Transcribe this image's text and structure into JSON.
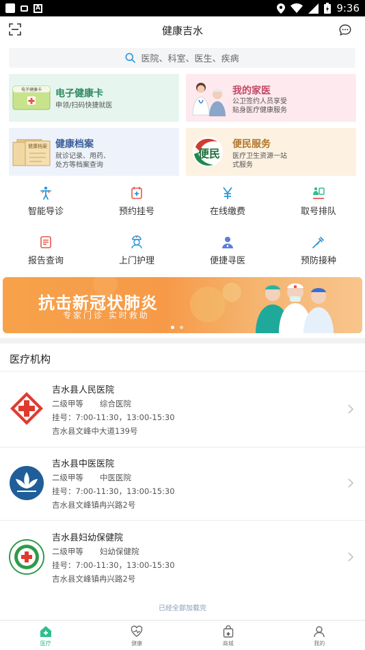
{
  "status_bar": {
    "time": "9:36"
  },
  "header": {
    "title": "健康吉水"
  },
  "search": {
    "placeholder": "医院、科室、医生、疾病"
  },
  "feature_cards": [
    {
      "title": "电子健康卡",
      "lines": [
        "申领/扫码快捷就医"
      ],
      "image_text": "电子健康卡"
    },
    {
      "title": "我的家医",
      "lines": [
        "公卫签约人员享受",
        "贴身医疗健康服务"
      ]
    },
    {
      "title": "健康档案",
      "lines": [
        "就诊记录、用药、",
        "处方等档案查询"
      ],
      "image_text": "健康档案"
    },
    {
      "title": "便民服务",
      "lines": [
        "医疗卫生资源一站",
        "式服务"
      ],
      "image_text": "便民"
    }
  ],
  "services": [
    {
      "label": "智能导诊",
      "icon": "body-guide-icon"
    },
    {
      "label": "预约挂号",
      "icon": "appointment-icon"
    },
    {
      "label": "在线缴费",
      "icon": "yen-icon"
    },
    {
      "label": "取号排队",
      "icon": "queue-icon"
    },
    {
      "label": "报告查询",
      "icon": "report-icon"
    },
    {
      "label": "上门护理",
      "icon": "nurse-icon"
    },
    {
      "label": "便捷寻医",
      "icon": "doctor-search-icon"
    },
    {
      "label": "预防接种",
      "icon": "vaccine-icon"
    }
  ],
  "banner": {
    "title": "抗击新冠状肺炎",
    "subtitle": "专家门诊  实时救助"
  },
  "section": {
    "title": "医疗机构"
  },
  "hospitals": [
    {
      "name": "吉水县人民医院",
      "level": "二级甲等",
      "type": "综合医院",
      "hours": "挂号：7:00-11:30，13:00-15:30",
      "address": "吉水县文峰中大道139号"
    },
    {
      "name": "吉水县中医医院",
      "level": "二级甲等",
      "type": "中医医院",
      "hours": "挂号：7:00-11:30，13:00-15:30",
      "address": "吉水县文峰镇冉兴路2号"
    },
    {
      "name": "吉水县妇幼保健院",
      "level": "二级甲等",
      "type": "妇幼保健院",
      "hours": "挂号：7:00-11:30，13:00-15:30",
      "address": "吉水县文峰镇冉兴路2号"
    }
  ],
  "footer_note": "已经全部加载完",
  "bottom_nav": [
    {
      "label": "医疗",
      "icon": "home-medical-icon",
      "active": true
    },
    {
      "label": "健康",
      "icon": "heart-icon",
      "active": false
    },
    {
      "label": "商城",
      "icon": "shop-bag-icon",
      "active": false
    },
    {
      "label": "我的",
      "icon": "profile-icon",
      "active": false
    }
  ],
  "colors": {
    "accent": "#2fbf8f",
    "icon_blue": "#2a96d8",
    "icon_red": "#e8584a"
  }
}
